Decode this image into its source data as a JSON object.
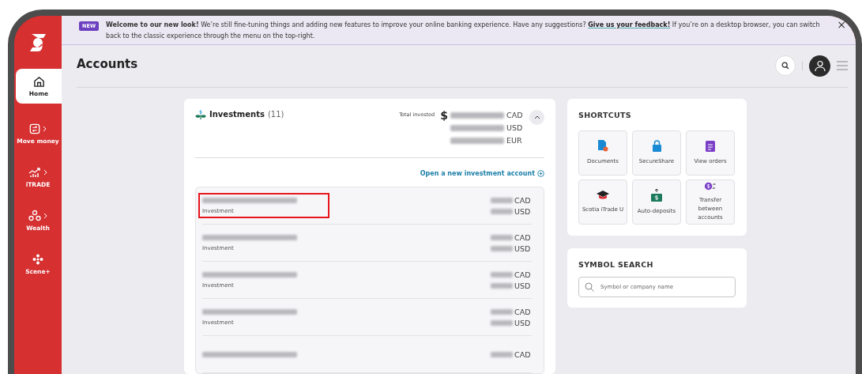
{
  "sidebar": {
    "items": [
      {
        "label": "Home",
        "kind": "home",
        "selected": true,
        "has_submenu": false
      },
      {
        "label": "Move money",
        "kind": "transfer",
        "selected": false,
        "has_submenu": true
      },
      {
        "label": "iTRADE",
        "kind": "chart",
        "selected": false,
        "has_submenu": true
      },
      {
        "label": "Wealth",
        "kind": "people",
        "selected": false,
        "has_submenu": true
      },
      {
        "label": "Scene+",
        "kind": "scene",
        "selected": false,
        "has_submenu": false
      }
    ]
  },
  "banner": {
    "badge": "NEW",
    "message_start": "**Welcome to our new look!** We’re still fine-tuning things and adding new features to improve your online banking experience. Have any suggestions?",
    "link": "Give us your feedback!",
    "message_end": "If you’re on a desktop browser, you can switch back to the classic experience through the menu on the top-right.",
    "close": "×"
  },
  "header": {
    "title": "Accounts"
  },
  "investments": {
    "title": "Investments",
    "count": "(11)",
    "total_label": "Total invested",
    "expanded": true,
    "totals": [
      {
        "prefix": "$",
        "currency": "CAD"
      },
      {
        "currency": "USD"
      },
      {
        "currency": "EUR"
      }
    ],
    "open_link": "Open a new investment account",
    "accounts": [
      {
        "type": "Investment",
        "currencies": [
          "CAD",
          "USD"
        ],
        "highlighted": true
      },
      {
        "type": "Investment",
        "currencies": [
          "CAD",
          "USD"
        ],
        "highlighted": false
      },
      {
        "type": "Investment",
        "currencies": [
          "CAD",
          "USD"
        ],
        "highlighted": false
      },
      {
        "type": "Investment",
        "currencies": [
          "CAD",
          "USD"
        ],
        "highlighted": false
      },
      {
        "currencies": [
          "CAD"
        ],
        "highlighted": false
      }
    ]
  },
  "shortcuts": {
    "title": "SHORTCUTS",
    "items": [
      {
        "label": "Documents",
        "kind": "document"
      },
      {
        "label": "SecureShare",
        "kind": "lock"
      },
      {
        "label": "View orders",
        "kind": "clipboard"
      },
      {
        "label": "Scotia iTrade U",
        "kind": "cap"
      },
      {
        "label": "Auto-deposits",
        "kind": "deposit"
      },
      {
        "label": "Transfer between accounts",
        "kind": "exchange"
      }
    ]
  },
  "symbol_search": {
    "title": "SYMBOL SEARCH",
    "placeholder": "Symbol or company name"
  }
}
